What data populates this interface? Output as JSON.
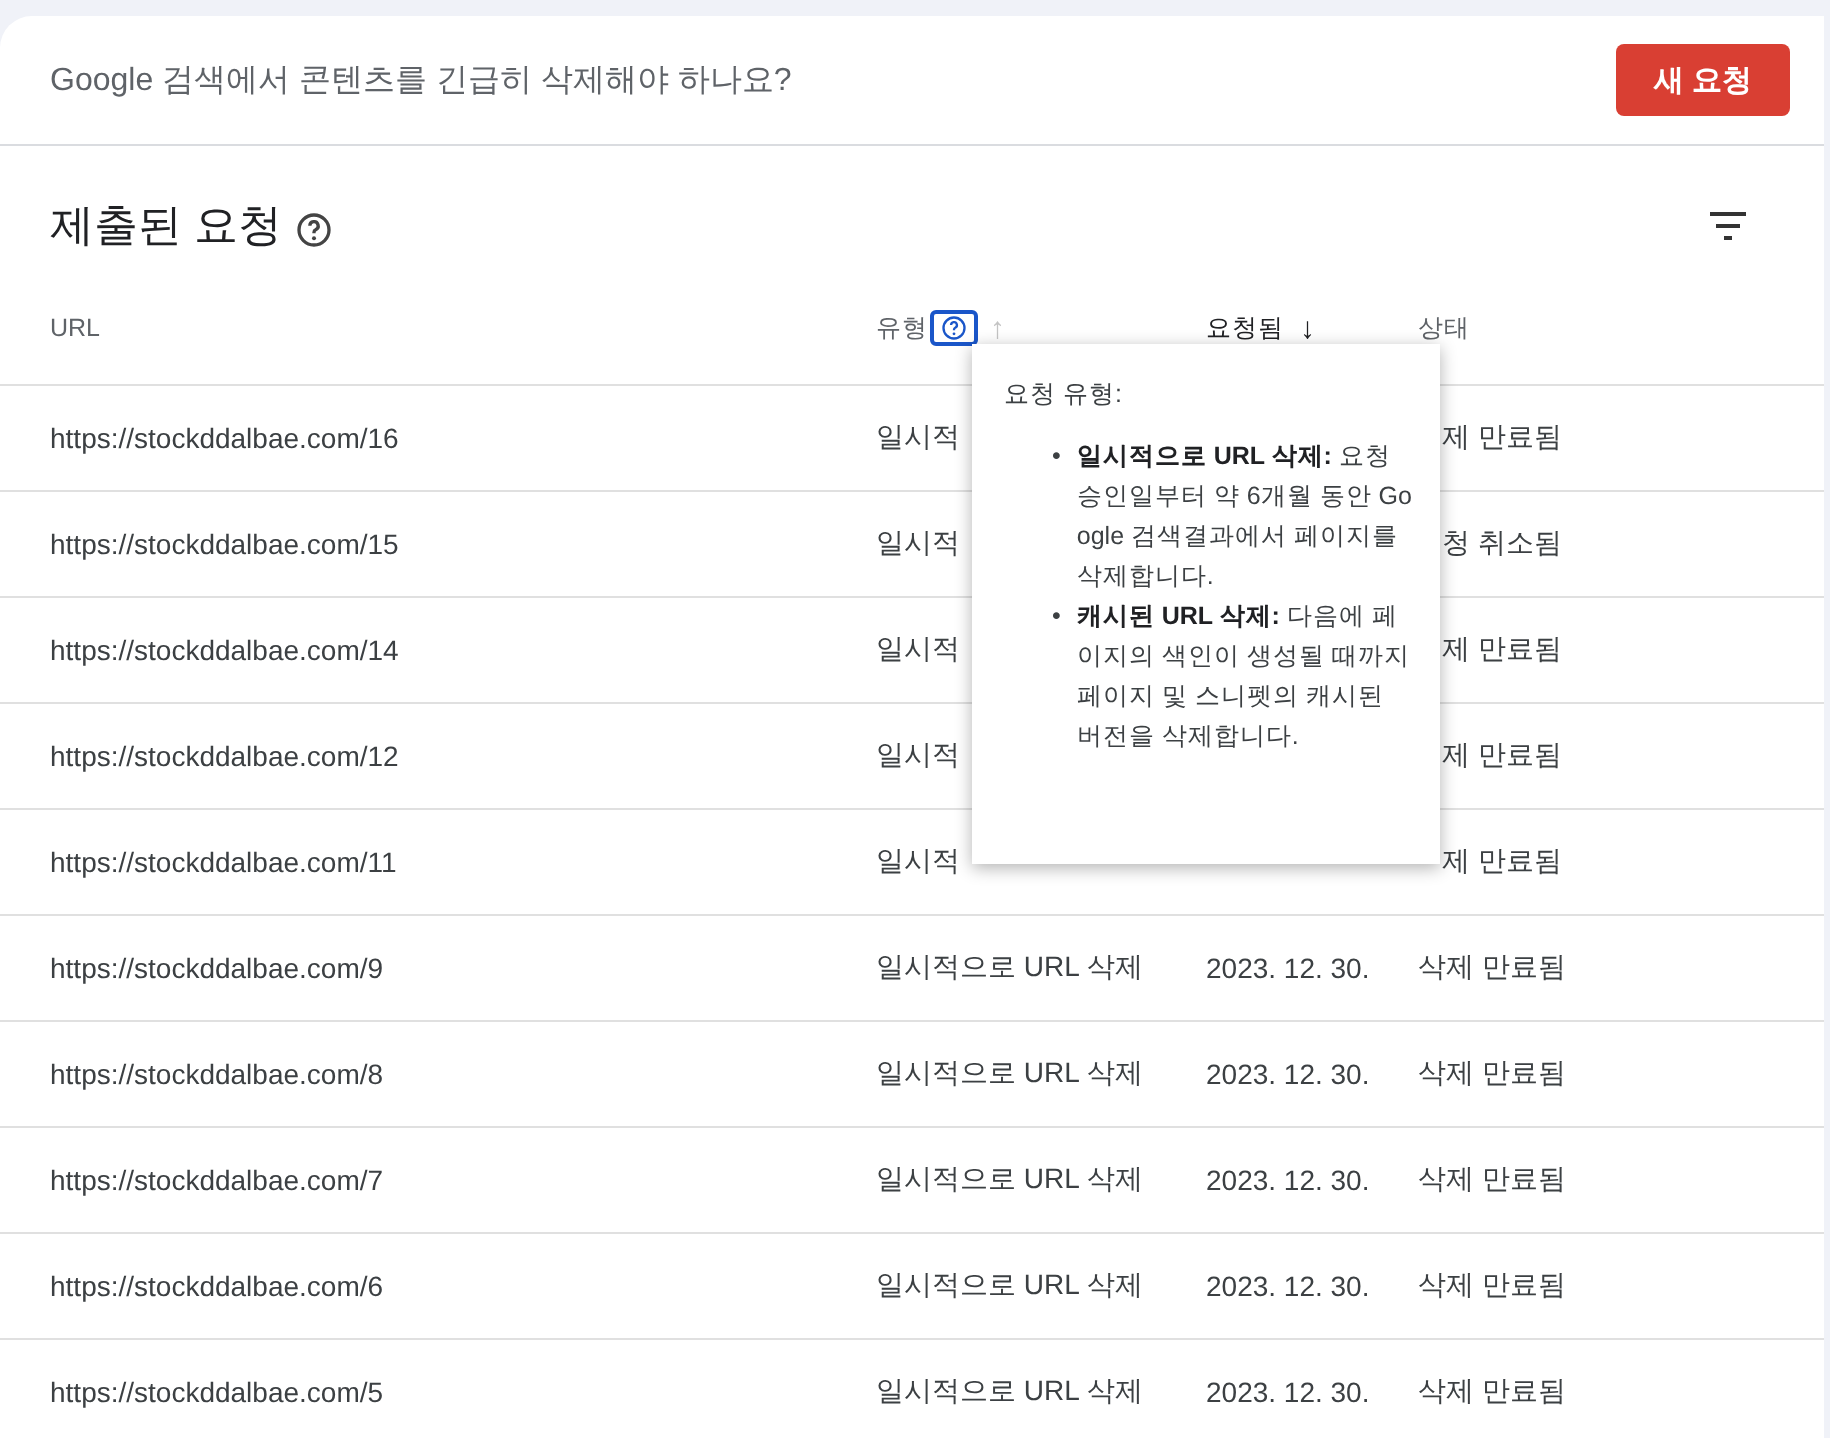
{
  "banner": {
    "question": "Google 검색에서 콘텐츠를 긴급히 삭제해야 하나요?",
    "button": "새 요청"
  },
  "section": {
    "title": "제출된 요청",
    "help": true,
    "filter": true
  },
  "table": {
    "columns": [
      {
        "label": "URL"
      },
      {
        "label": "유형",
        "help": true,
        "help_focused": true,
        "sort_arrow": "↑",
        "sort_active": false
      },
      {
        "label": "요청됨",
        "sort_arrow": "↓",
        "sort_active": true
      },
      {
        "label": "상태"
      }
    ],
    "rows": [
      {
        "url": "https://stockddalbae.com/16",
        "type": "일시적",
        "status": "제 만료됨",
        "status_clipped": true
      },
      {
        "url": "https://stockddalbae.com/15",
        "type": "일시적",
        "status": "청 취소됨",
        "status_clipped": true
      },
      {
        "url": "https://stockddalbae.com/14",
        "type": "일시적",
        "status": "제 만료됨",
        "status_clipped": true
      },
      {
        "url": "https://stockddalbae.com/12",
        "type": "일시적",
        "status": "제 만료됨",
        "status_clipped": true
      },
      {
        "url": "https://stockddalbae.com/11",
        "type": "일시적",
        "status": "제 만료됨",
        "status_clipped": true
      },
      {
        "url": "https://stockddalbae.com/9",
        "type": "일시적으로 URL 삭제",
        "date": "2023. 12. 30.",
        "status": "삭제 만료됨"
      },
      {
        "url": "https://stockddalbae.com/8",
        "type": "일시적으로 URL 삭제",
        "date": "2023. 12. 30.",
        "status": "삭제 만료됨"
      },
      {
        "url": "https://stockddalbae.com/7",
        "type": "일시적으로 URL 삭제",
        "date": "2023. 12. 30.",
        "status": "삭제 만료됨"
      },
      {
        "url": "https://stockddalbae.com/6",
        "type": "일시적으로 URL 삭제",
        "date": "2023. 12. 30.",
        "status": "삭제 만료됨"
      },
      {
        "url": "https://stockddalbae.com/5",
        "type": "일시적으로 URL 삭제",
        "date": "2023. 12. 30.",
        "status": "삭제 만료됨"
      }
    ]
  },
  "tooltip": {
    "title": "요청 유형:",
    "items": [
      {
        "bullet": "•",
        "text": "**일시적으로 URL 삭제:** 요청 승인일부터 약 6개월 동안 Google 검색결과에서 페이지를 삭제합니다."
      },
      {
        "bullet": "•",
        "text": "**캐시된 URL 삭제:** 다음에 페이지의 색인이 생성될 때까지 페이지 및 스니펫의 캐시된 버전을 삭제합니다."
      }
    ]
  }
}
